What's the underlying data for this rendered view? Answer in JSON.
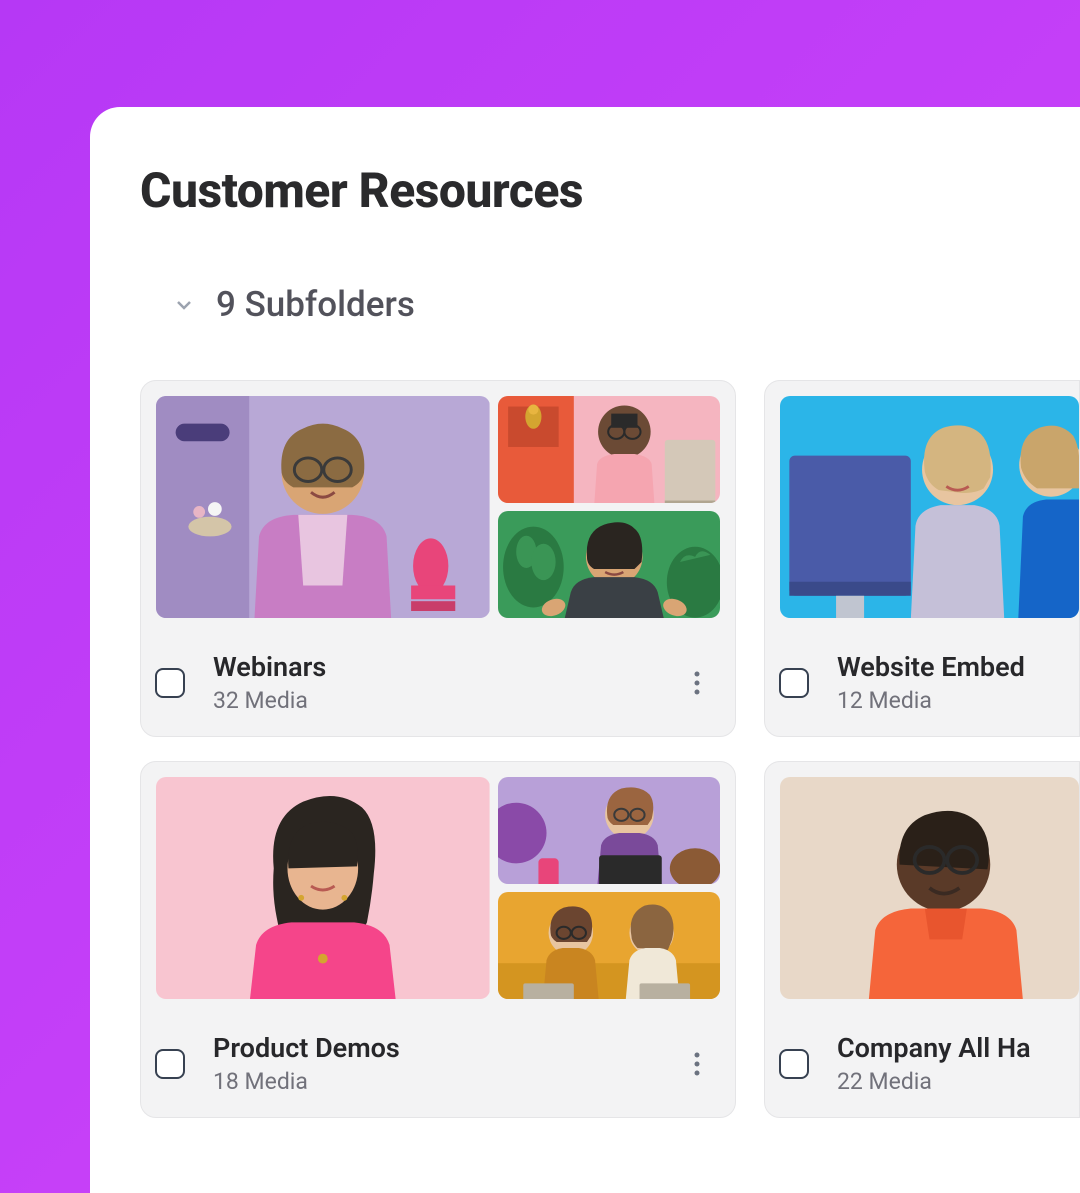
{
  "page": {
    "title": "Customer Resources"
  },
  "subfolders": {
    "count_label": "9 Subfolders"
  },
  "folders": [
    {
      "title": "Webinars",
      "count": "32 Media"
    },
    {
      "title": "Website Embed",
      "count": "12 Media"
    },
    {
      "title": "Product Demos",
      "count": "18 Media"
    },
    {
      "title": "Company All Ha",
      "count": "22 Media"
    }
  ]
}
